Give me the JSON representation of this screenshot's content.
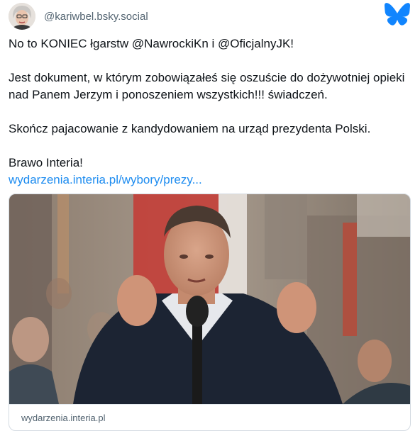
{
  "post": {
    "handle": "@kariwbel.bsky.social",
    "lines": [
      "No to KONIEC łgarstw @NawrockiKn i @OficjalnyJK!",
      "Jest dokument, w którym zobowiązałeś się oszuście do dożywotniej opieki nad Panem Jerzym i ponoszeniem wszystkich!!! świadczeń.",
      "Skończ pajacowanie z kandydowaniem na urząd prezydenta Polski.",
      "Brawo Interia!"
    ],
    "link_text": "wydarzenia.interia.pl/wybory/prezy..."
  },
  "card": {
    "domain": "wydarzenia.interia.pl"
  },
  "icons": {
    "platform": "butterfly-icon"
  },
  "colors": {
    "accent": "#1185fe",
    "link": "#1d8cf0",
    "muted": "#536471"
  }
}
